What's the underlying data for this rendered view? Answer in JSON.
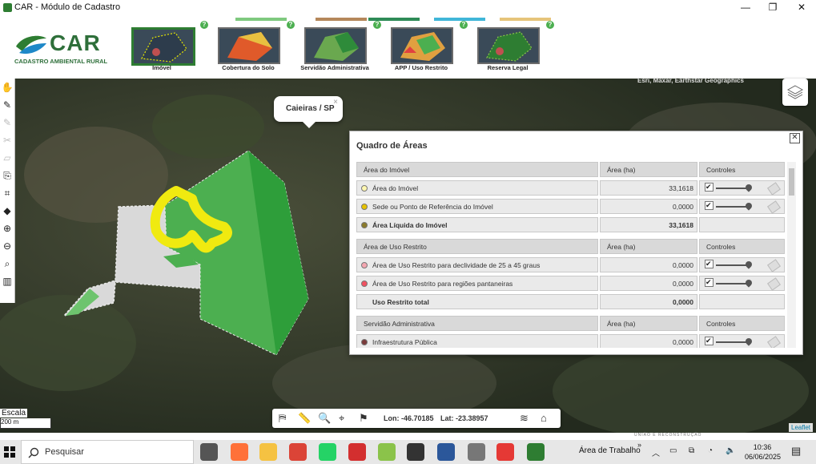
{
  "window": {
    "title": "CAR - Módulo de Cadastro",
    "controls": [
      "—",
      "❐",
      "✕"
    ]
  },
  "logo": {
    "name": "CAR",
    "subtitle": "CADASTRO AMBIENTAL RURAL"
  },
  "steps": [
    {
      "label": "Imóvel",
      "bar_color": "#ffffff",
      "active": true
    },
    {
      "label": "Cobertura do Solo",
      "bar_color": "#7fc97f",
      "active": false
    },
    {
      "label": "Servidão Administrativa",
      "bar_color": "#b5875a",
      "active": false
    },
    {
      "label": "APP / Uso Restrito",
      "bar_color": "#2e8b57",
      "active": false
    },
    {
      "label": "Reserva Legal",
      "bar_color": "#40b6d8",
      "active": false
    }
  ],
  "extra_step_bar_color": "#e6c47a",
  "help_glyph": "?",
  "popup": {
    "text": "Caieiras / SP",
    "close": "×"
  },
  "quadro": {
    "title": "Quadro de Áreas",
    "close": "✕",
    "sections": [
      {
        "header": "Área do Imóvel",
        "col2": "Área (ha)",
        "col3": "Controles",
        "rows": [
          {
            "label": "Área do Imóvel",
            "value": "33,1618",
            "dot": "#fff7b0",
            "controls": true,
            "bold": false
          },
          {
            "label": "Sede ou Ponto de Referência do Imóvel",
            "value": "0,0000",
            "dot": "#e6c200",
            "controls": true,
            "bold": false
          },
          {
            "label": "Área Líquida do Imóvel",
            "value": "33,1618",
            "dot": "#8a7a2a",
            "controls": false,
            "bold": true
          }
        ]
      },
      {
        "header": "Área de Uso Restrito",
        "col2": "Área (ha)",
        "col3": "Controles",
        "rows": [
          {
            "label": "Área de Uso Restrito para declividade de 25 a 45 graus",
            "value": "0,0000",
            "dot": "#f4a6b0",
            "controls": true,
            "bold": false
          },
          {
            "label": "Área de Uso Restrito para regiões pantaneiras",
            "value": "0,0000",
            "dot": "#f05060",
            "controls": true,
            "bold": false
          },
          {
            "label": "Uso Restrito total",
            "value": "0,0000",
            "dot": "",
            "controls": false,
            "bold": true
          }
        ]
      },
      {
        "header": "Servidão Administrativa",
        "col2": "Área (ha)",
        "col3": "Controles",
        "rows": [
          {
            "label": "Infraestrutura Pública",
            "value": "0,0000",
            "dot": "#7a3b3b",
            "controls": true,
            "bold": false
          }
        ]
      }
    ]
  },
  "mapbar": {
    "lon": "Lon: -46.70185",
    "lat": "Lat: -23.38957"
  },
  "scale": {
    "label": "Escala",
    "value": "200 m"
  },
  "attribution": {
    "leaflet": "Leaflet",
    "uniao": "UNIÃO E RECONSTRUÇÃO",
    "top": "Esri, Maxar, Earthstar Geographics"
  },
  "taskbar": {
    "search_placeholder": "Pesquisar",
    "desktop": "Área de Trabalho",
    "time": "10:36",
    "date": "06/06/2025",
    "apps": [
      {
        "name": "task-view",
        "color": "#555555"
      },
      {
        "name": "firefox",
        "color": "#ff7139"
      },
      {
        "name": "file-explorer",
        "color": "#f5c242"
      },
      {
        "name": "chrome",
        "color": "#db4437"
      },
      {
        "name": "whatsapp",
        "color": "#25d366"
      },
      {
        "name": "acrobat",
        "color": "#d32f2f"
      },
      {
        "name": "qgis",
        "color": "#8bc34a"
      },
      {
        "name": "app-dark",
        "color": "#333333"
      },
      {
        "name": "word",
        "color": "#2b579a"
      },
      {
        "name": "app-globe",
        "color": "#777777"
      },
      {
        "name": "pdf",
        "color": "#e53935"
      },
      {
        "name": "car-app",
        "color": "#2e7d32"
      }
    ]
  }
}
